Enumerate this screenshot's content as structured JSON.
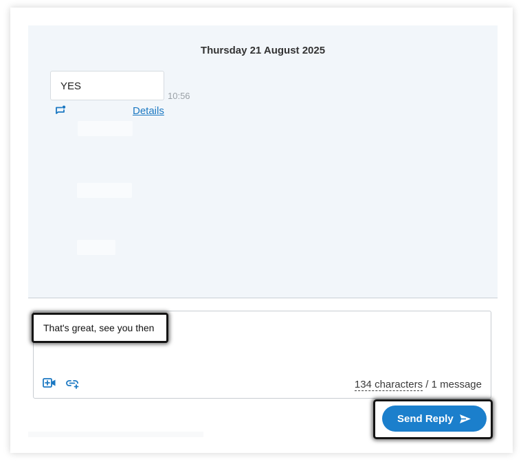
{
  "thread": {
    "date_heading": "Thursday 21 August 2025",
    "messages": [
      {
        "text": "YES",
        "time": "10:56",
        "details_label": "Details"
      }
    ]
  },
  "composer": {
    "text": "That's great, see you then",
    "char_count": "134 characters",
    "message_count": " / 1 message"
  },
  "actions": {
    "send_label": "Send Reply"
  },
  "icons": {
    "comment": "comment-plus-icon",
    "video": "add-video-icon",
    "link": "add-link-icon",
    "send": "send-arrow-icon"
  },
  "colors": {
    "accent": "#1b7fcc",
    "link": "#1b78c2",
    "thread_bg": "#f2f6fa"
  }
}
